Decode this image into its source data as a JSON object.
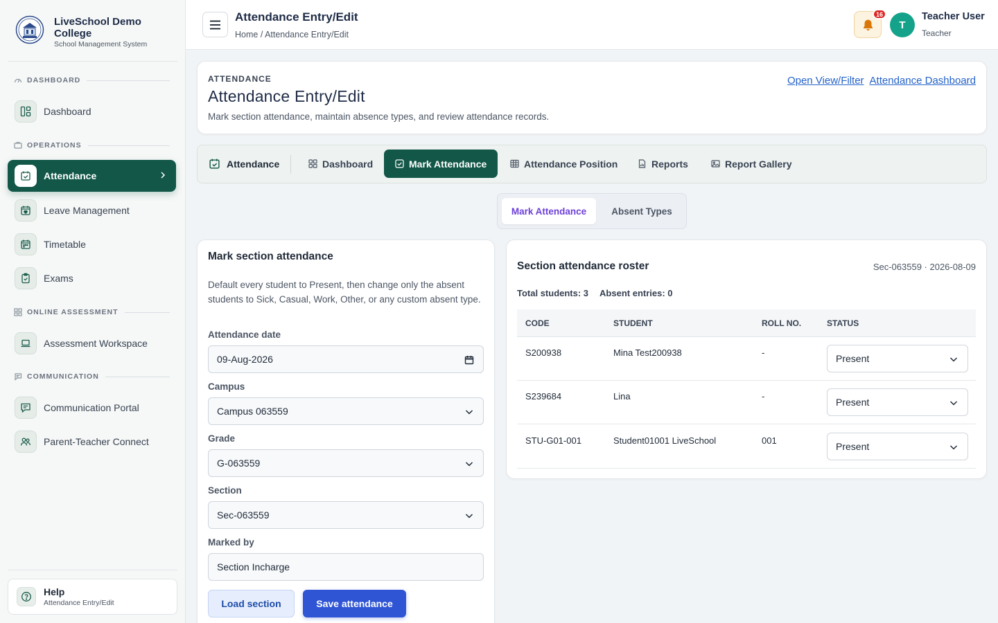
{
  "brand": {
    "name": "LiveSchool Demo College",
    "subtitle": "School Management System"
  },
  "sidebar": {
    "sections": [
      {
        "label": "DASHBOARD",
        "icon": "gauge-icon"
      },
      {
        "label": "OPERATIONS",
        "icon": "briefcase-icon"
      },
      {
        "label": "ONLINE ASSESSMENT",
        "icon": "grid-icon"
      },
      {
        "label": "COMMUNICATION",
        "icon": "chat-icon"
      }
    ],
    "items": [
      {
        "label": "Dashboard",
        "icon": "layout-icon"
      },
      {
        "label": "Attendance",
        "icon": "calendar-check-icon",
        "active": true
      },
      {
        "label": "Leave Management",
        "icon": "calendar-heart-icon"
      },
      {
        "label": "Timetable",
        "icon": "calendar-grid-icon"
      },
      {
        "label": "Exams",
        "icon": "clipboard-check-icon"
      },
      {
        "label": "Assessment Workspace",
        "icon": "laptop-icon"
      },
      {
        "label": "Communication Portal",
        "icon": "message-icon"
      },
      {
        "label": "Parent-Teacher Connect",
        "icon": "users-icon"
      }
    ],
    "help": {
      "title": "Help",
      "subtitle": "Attendance Entry/Edit"
    }
  },
  "topbar": {
    "title": "Attendance Entry/Edit",
    "breadcrumb": "Home / Attendance Entry/Edit",
    "notifications": "16",
    "user": {
      "initial": "T",
      "name": "Teacher User",
      "role": "Teacher"
    }
  },
  "header": {
    "kicker": "ATTENDANCE",
    "title": "Attendance Entry/Edit",
    "description": "Mark section attendance, maintain absence types, and review attendance records.",
    "links": [
      "Open View/Filter",
      "Attendance Dashboard"
    ]
  },
  "tabs": {
    "main": "Attendance",
    "items": [
      "Dashboard",
      "Mark Attendance",
      "Attendance Position",
      "Reports",
      "Report Gallery"
    ],
    "active_index": 1
  },
  "segment": {
    "options": [
      "Mark Attendance",
      "Absent Types"
    ],
    "active": "Mark Attendance"
  },
  "form": {
    "title": "Mark section attendance",
    "description": "Default every student to Present, then change only the absent students to Sick, Casual, Work, Other, or any custom absent type.",
    "fields": [
      {
        "label": "Attendance date",
        "value": "09-Aug-2026"
      },
      {
        "label": "Campus",
        "value": "Campus 063559"
      },
      {
        "label": "Grade",
        "value": "G-063559"
      },
      {
        "label": "Section",
        "value": "Sec-063559"
      },
      {
        "label": "Marked by",
        "value": "Section Incharge"
      }
    ],
    "load_button": "Load section",
    "save_button": "Save attendance"
  },
  "roster": {
    "title": "Section attendance roster",
    "meta": "Sec-063559 · 2026-08-09",
    "total": "Total students: 3",
    "absent": "Absent entries: 0",
    "columns": [
      "CODE",
      "STUDENT",
      "ROLL NO.",
      "STATUS"
    ],
    "rows": [
      {
        "code": "S200938",
        "student": "Mina Test200938",
        "roll": "-",
        "status": "Present"
      },
      {
        "code": "S239684",
        "student": "Lina",
        "roll": "-",
        "status": "Present"
      },
      {
        "code": "STU-G01-001",
        "student": "Student01001 LiveSchool",
        "roll": "001",
        "status": "Present"
      }
    ]
  },
  "colors": {
    "primary": "#125748",
    "accent": "#2f55d4",
    "segment_active": "#6d3fd9",
    "badge": "#dc2626",
    "avatar": "#14a38a"
  }
}
